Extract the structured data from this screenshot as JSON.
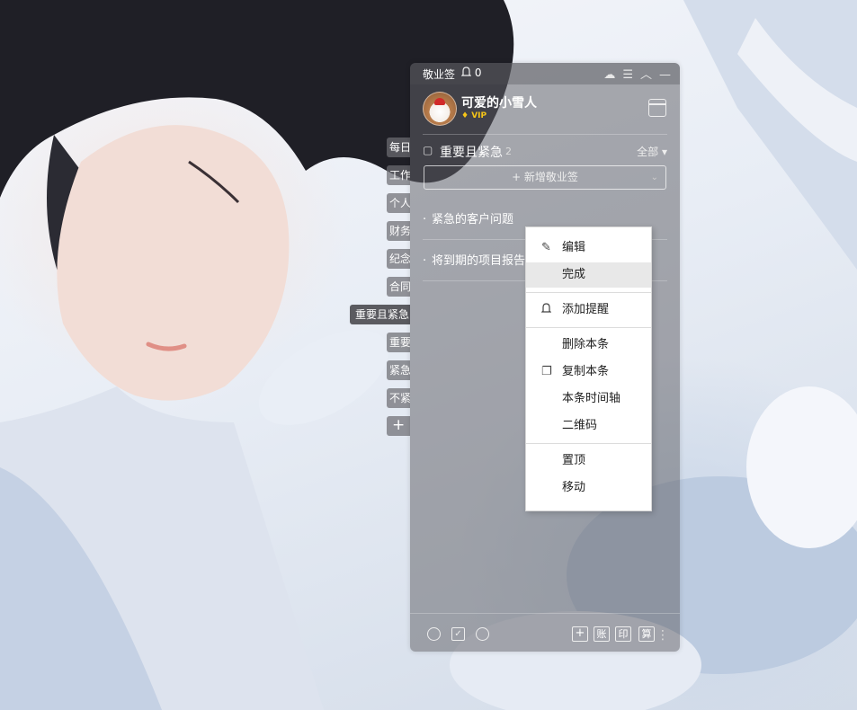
{
  "app": {
    "name": "敬业签",
    "notification_count": "0"
  },
  "user": {
    "name": "可爱的小雪人",
    "badge": "VIP"
  },
  "categories": [
    {
      "label": "每日"
    },
    {
      "label": "工作"
    },
    {
      "label": "个人"
    },
    {
      "label": "财务"
    },
    {
      "label": "纪念"
    },
    {
      "label": "合同"
    },
    {
      "label": "重要且紧急",
      "active": true
    },
    {
      "label": "重要"
    },
    {
      "label": "紧急"
    },
    {
      "label": "不紧"
    },
    {
      "label": "+"
    }
  ],
  "section": {
    "title": "重要且紧急",
    "count": "2",
    "filter": "全部"
  },
  "add_note_label": "+ 新增敬业签",
  "notes": [
    {
      "text": "紧急的客户问题"
    },
    {
      "text": "将到期的项目报告"
    }
  ],
  "context_menu": {
    "items": [
      {
        "label": "编辑",
        "icon": "edit-icon"
      },
      {
        "label": "完成",
        "hovered": true
      },
      {
        "label": "添加提醒",
        "icon": "bell-icon"
      },
      {
        "label": "删除本条"
      },
      {
        "label": "复制本条",
        "icon": "copy-icon"
      },
      {
        "label": "本条时间轴"
      },
      {
        "label": "二维码"
      },
      {
        "label": "置顶"
      },
      {
        "label": "移动"
      }
    ]
  },
  "bottom_bar": {
    "text_buttons": [
      "账",
      "印",
      "算"
    ]
  }
}
